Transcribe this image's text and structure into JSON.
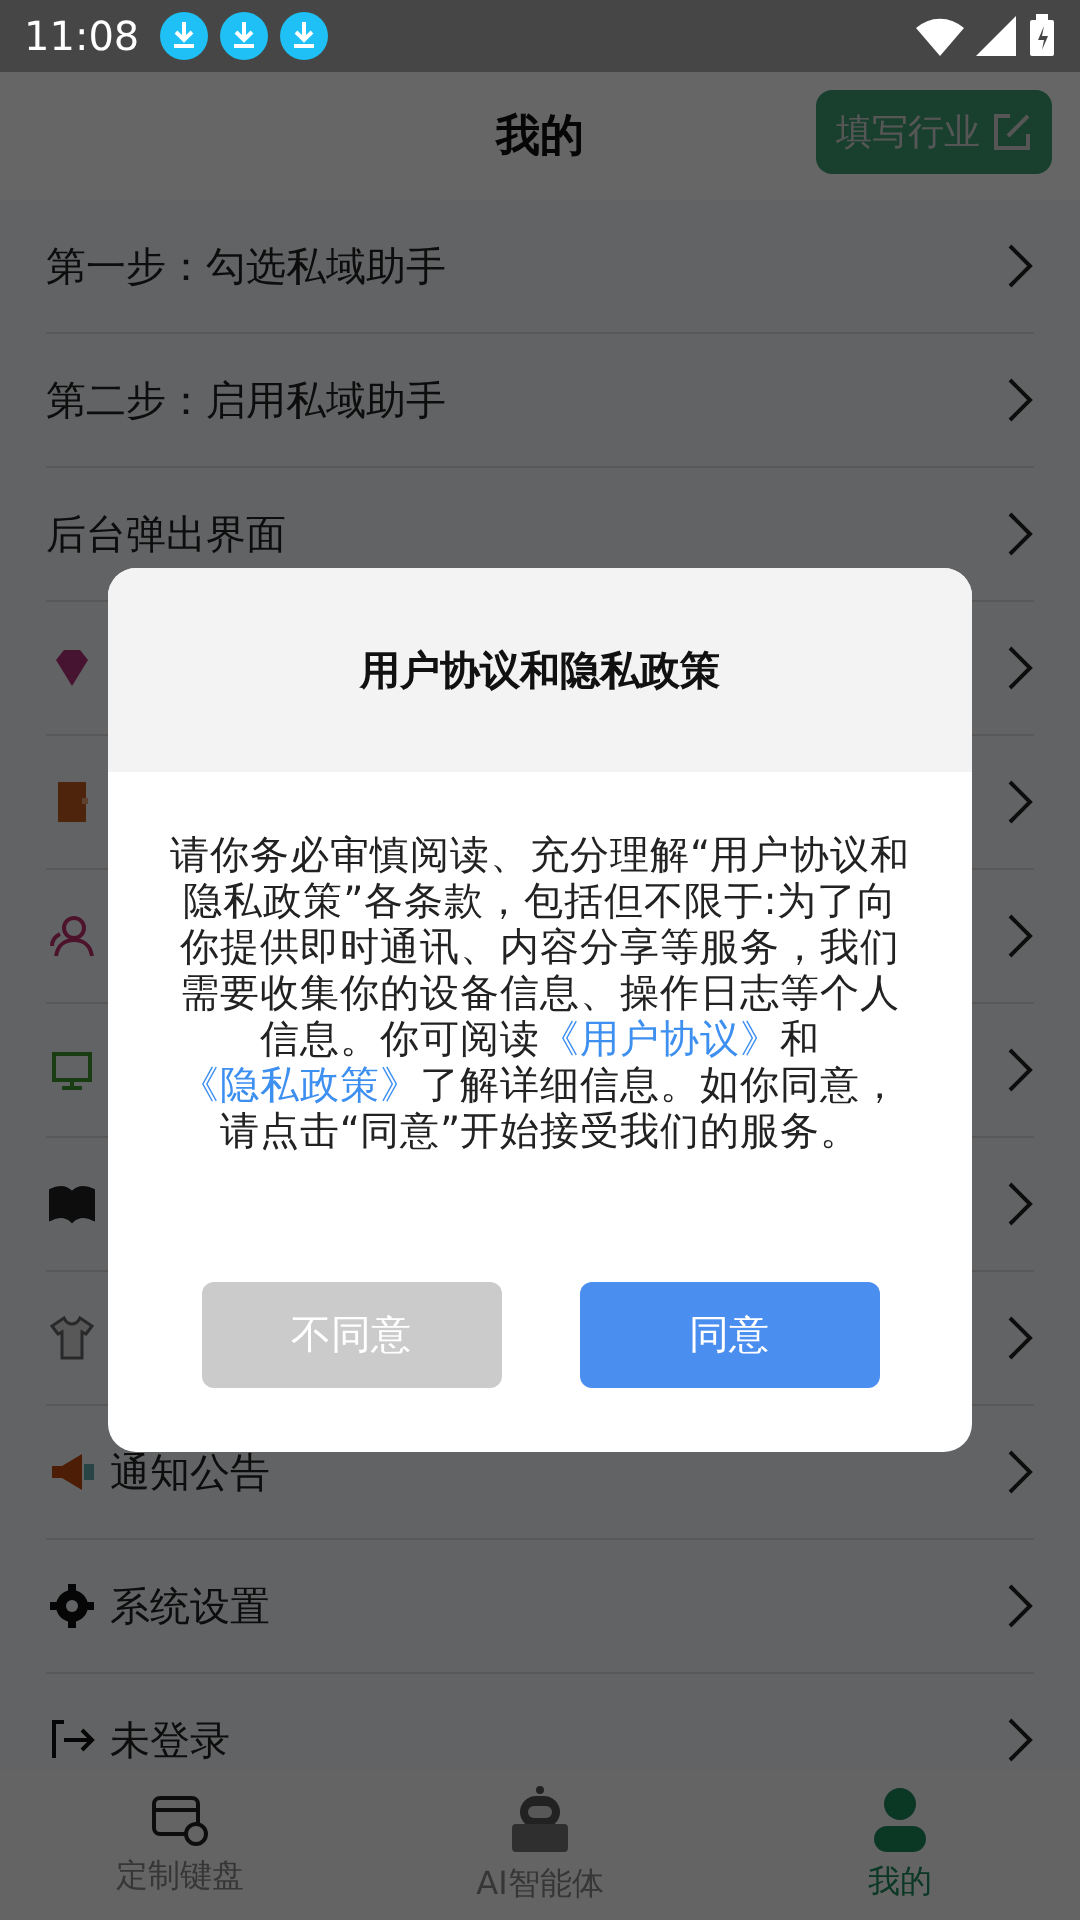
{
  "status_bar": {
    "time": "11:08"
  },
  "header": {
    "title": "我的",
    "action": "填写行业"
  },
  "menu": [
    {
      "kind": "text",
      "label": "第一步：勾选私域助手"
    },
    {
      "kind": "text",
      "label": "第二步：启用私域助手"
    },
    {
      "kind": "text",
      "label": "后台弹出界面"
    },
    {
      "kind": "covered"
    },
    {
      "kind": "covered"
    },
    {
      "kind": "covered"
    },
    {
      "kind": "covered"
    },
    {
      "kind": "covered"
    },
    {
      "kind": "covered"
    },
    {
      "kind": "text",
      "label": "通知公告"
    },
    {
      "kind": "text",
      "label": "系统设置"
    },
    {
      "kind": "text",
      "label": "未登录"
    }
  ],
  "dialog": {
    "title": "用户协议和隐私政策",
    "body": [
      {
        "text": "请你务必审慎阅读、充分理解“用户协议和隐私政策”各条款，包括但不限于:为了向你提供即时通讯、内容分享等服务，我们需要收集你的设备信息、操作日志等个人信息。你可阅读",
        "link": false
      },
      {
        "text": "《用户协议》",
        "link": true
      },
      {
        "text": "和",
        "link": false
      },
      {
        "text": "《隐私政策》",
        "link": true
      },
      {
        "text": "了解详细信息。如你同意，请点击“同意”开始接受我们的服务。",
        "link": false
      }
    ],
    "buttons": [
      {
        "label": "不同意",
        "kind": "secondary"
      },
      {
        "label": "同意",
        "kind": "primary"
      }
    ]
  },
  "tabs": [
    {
      "label": "定制键盘",
      "selected": false
    },
    {
      "label": "AI智能体",
      "selected": false
    },
    {
      "label": "我的",
      "selected": true
    }
  ]
}
